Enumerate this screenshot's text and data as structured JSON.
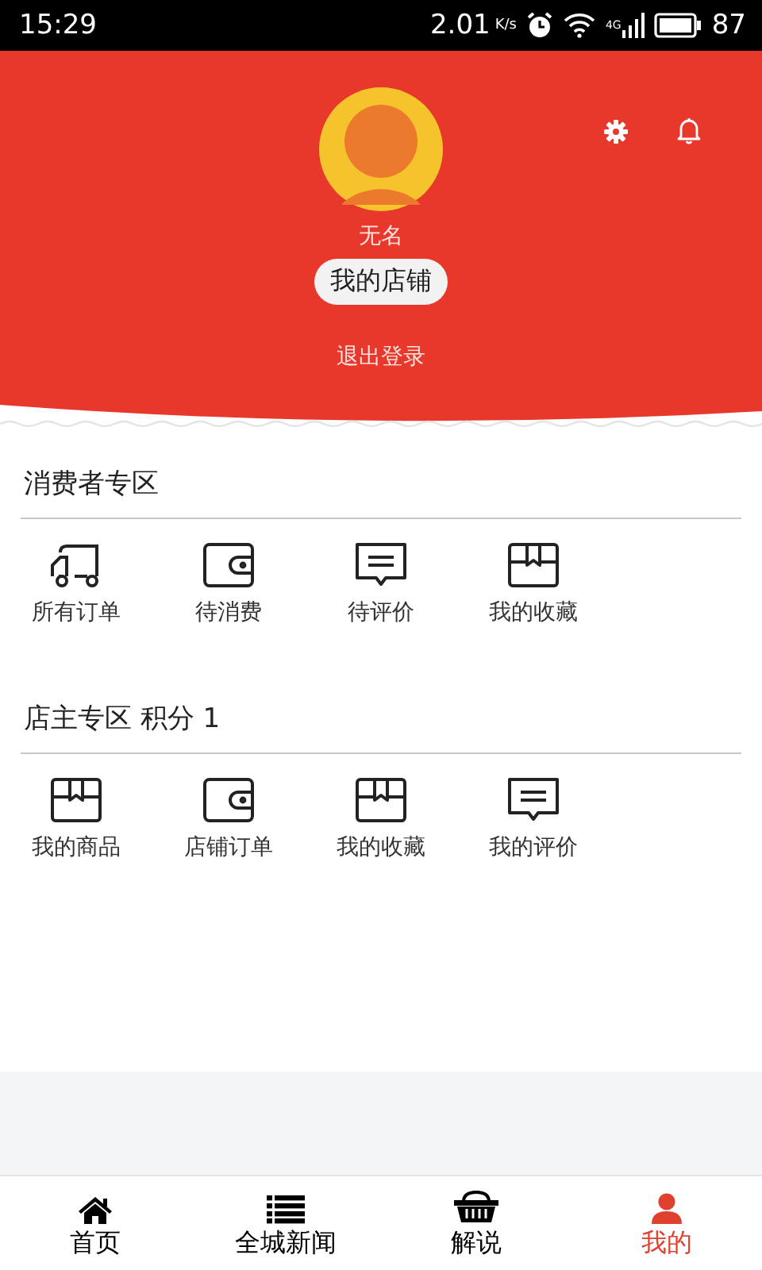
{
  "status_bar": {
    "time": "15:29",
    "speed": "2.01",
    "speed_unit": "K/s",
    "network": "4G",
    "battery": "87"
  },
  "profile": {
    "name": "无名",
    "shop_button": "我的店铺",
    "logout": "退出登录"
  },
  "sections": [
    {
      "title": "消费者专区",
      "items": [
        {
          "label": "所有订单",
          "kind": "truck"
        },
        {
          "label": "待消费",
          "kind": "wallet"
        },
        {
          "label": "待评价",
          "kind": "comment"
        },
        {
          "label": "我的收藏",
          "kind": "box"
        }
      ]
    },
    {
      "title": "店主专区 积分 1",
      "items": [
        {
          "label": "我的商品",
          "kind": "box"
        },
        {
          "label": "店铺订单",
          "kind": "wallet"
        },
        {
          "label": "我的收藏",
          "kind": "box"
        },
        {
          "label": "我的评价",
          "kind": "comment"
        }
      ]
    }
  ],
  "tabs": [
    {
      "label": "首页",
      "kind": "home",
      "selected": false
    },
    {
      "label": "全城新闻",
      "kind": "list",
      "selected": false
    },
    {
      "label": "解说",
      "kind": "basket",
      "selected": false
    },
    {
      "label": "我的",
      "kind": "user",
      "selected": true
    }
  ]
}
